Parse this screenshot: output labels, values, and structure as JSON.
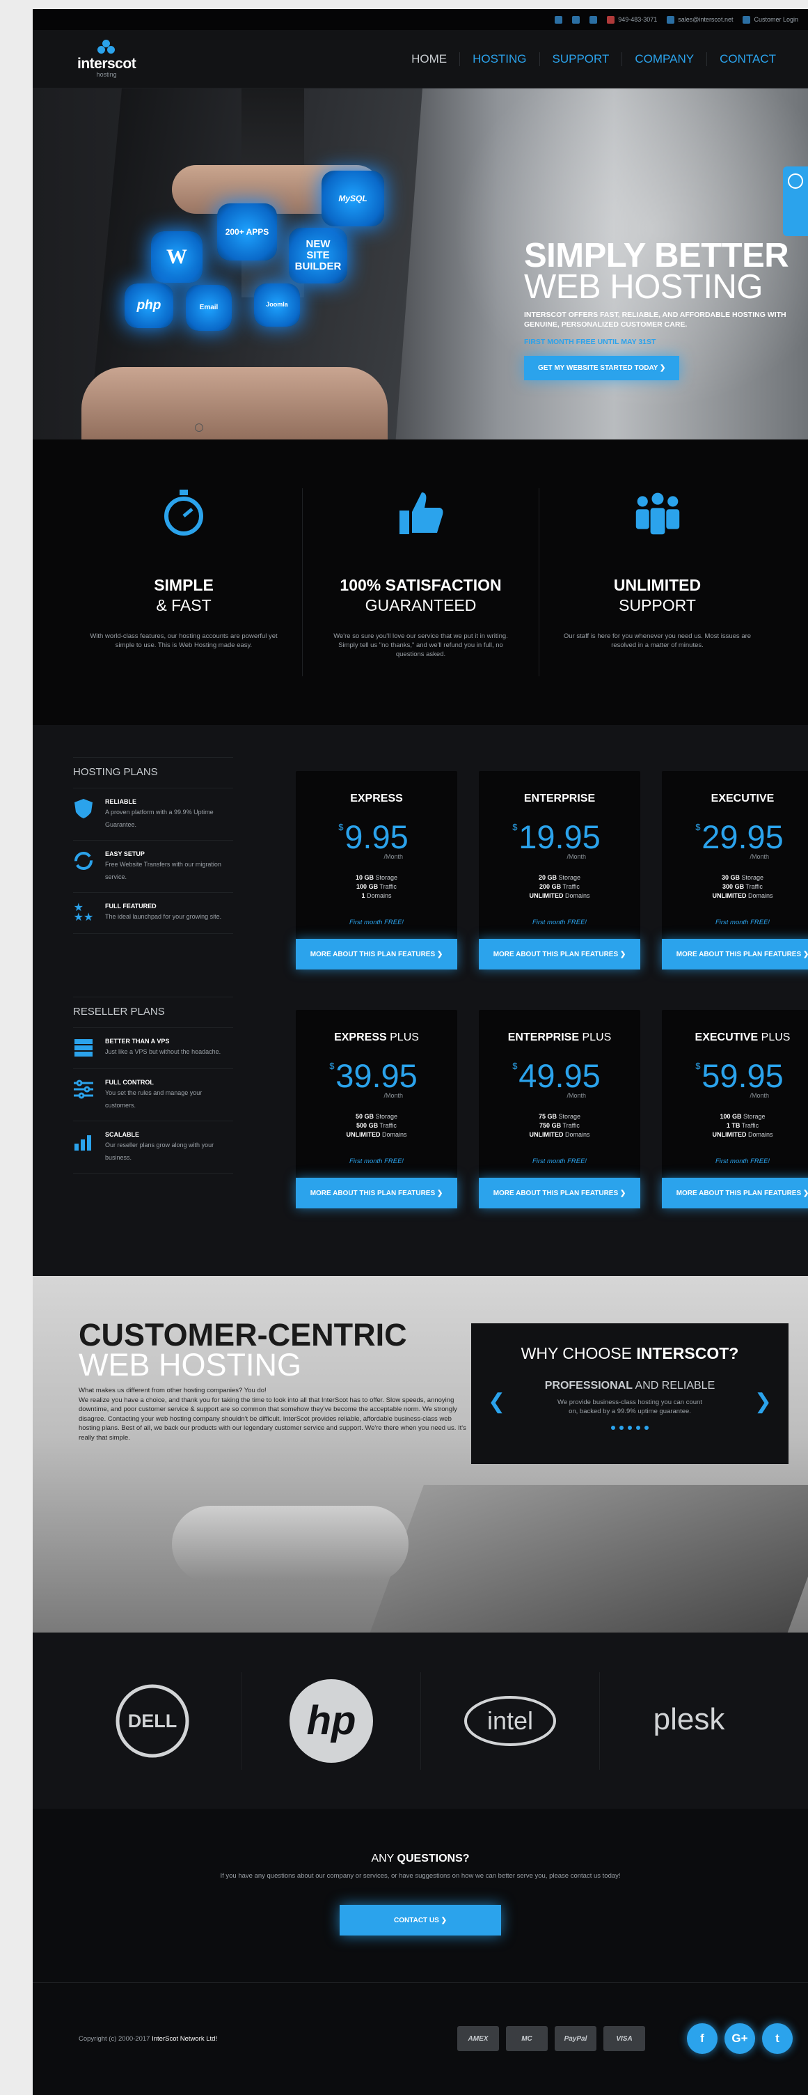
{
  "util": {
    "phone": "949-483-3071",
    "email": "sales@interscot.net",
    "login": "Customer Login",
    "flag": "US"
  },
  "header": {
    "logo_name": "interscot",
    "logo_sub": "hosting",
    "nav": [
      "HOME",
      "HOSTING",
      "SUPPORT",
      "COMPANY",
      "CONTACT"
    ]
  },
  "hero": {
    "gears": [
      "WordPress",
      "php",
      "200+ APPS",
      "Email",
      "NEW SITE BUILDER",
      "MySQL",
      "Joomla"
    ],
    "title_bold": "SIMPLY BETTER",
    "title_light": "WEB HOSTING",
    "text": "INTERSCOT OFFERS FAST, RELIABLE, AND AFFORDABLE HOSTING WITH GENUINE, PERSONALIZED CUSTOMER CARE.",
    "promo": "FIRST MONTH FREE UNTIL MAY 31ST",
    "cta": "GET MY WEBSITE STARTED TODAY ❯"
  },
  "features": [
    {
      "icon": "stopwatch-icon",
      "title": "SIMPLE",
      "sub": "& FAST",
      "text": "With world-class features, our hosting accounts are powerful yet simple to use. This is Web Hosting made easy."
    },
    {
      "icon": "thumbs-up-icon",
      "title": "100% SATISFACTION",
      "sub": "GUARANTEED",
      "text": "We're so sure you'll love our service that we put it in writing. Simply tell us \"no thanks,\" and we'll refund you in full, no questions asked."
    },
    {
      "icon": "team-icon",
      "title": "UNLIMITED",
      "sub": "SUPPORT",
      "text": "Our staff is here for you whenever you need us. Most issues are resolved in a matter of minutes."
    }
  ],
  "plans": {
    "hosting_title": "HOSTING PLANS",
    "hosting_perks": [
      {
        "icon": "shield-icon",
        "title": "RELIABLE",
        "text": "A proven platform with a 99.9% Uptime Guarantee."
      },
      {
        "icon": "sync-icon",
        "title": "EASY SETUP",
        "text": "Free Website Transfers with our migration service."
      },
      {
        "icon": "stars-icon",
        "title": "FULL FEATURED",
        "text": "The ideal launchpad for your growing site."
      }
    ],
    "reseller_title": "RESELLER PLANS",
    "reseller_perks": [
      {
        "icon": "server-icon",
        "title": "BETTER THAN A VPS",
        "text": "Just like a VPS but without the headache."
      },
      {
        "icon": "sliders-icon",
        "title": "FULL CONTROL",
        "text": "You set the rules and manage your customers."
      },
      {
        "icon": "growth-chart-icon",
        "title": "SCALABLE",
        "text": "Our reseller plans grow along with your business."
      }
    ],
    "cards": [
      {
        "name": "EXPRESS",
        "suffix": "",
        "price": "9.95",
        "storage": "10 GB",
        "traffic": "100 GB",
        "domains": "1"
      },
      {
        "name": "ENTERPRISE",
        "suffix": "",
        "price": "19.95",
        "storage": "20 GB",
        "traffic": "200 GB",
        "domains": "UNLIMITED"
      },
      {
        "name": "EXECUTIVE",
        "suffix": "",
        "price": "29.95",
        "storage": "30 GB",
        "traffic": "300 GB",
        "domains": "UNLIMITED"
      },
      {
        "name": "EXPRESS",
        "suffix": " PLUS",
        "price": "39.95",
        "storage": "50 GB",
        "traffic": "500 GB",
        "domains": "UNLIMITED"
      },
      {
        "name": "ENTERPRISE",
        "suffix": " PLUS",
        "price": "49.95",
        "storage": "75 GB",
        "traffic": "750 GB",
        "domains": "UNLIMITED"
      },
      {
        "name": "EXECUTIVE",
        "suffix": " PLUS",
        "price": "59.95",
        "storage": "100 GB",
        "traffic": "1 TB",
        "domains": "UNLIMITED"
      }
    ],
    "currency": "$",
    "per": "/Month",
    "storage_label": "Storage",
    "traffic_label": "Traffic",
    "domains_label": "Domains",
    "first_month": "First month FREE!",
    "more": "MORE ABOUT THIS PLAN FEATURES ❯"
  },
  "customer": {
    "title_bold": "CUSTOMER-CENTRIC",
    "title_light": "WEB HOSTING",
    "lead": "What makes us different from other hosting companies? You do!",
    "text": "We realize you have a choice, and thank you for taking the time to look into all that InterScot has to offer. Slow speeds, annoying downtime, and poor customer service & support are so common that somehow they've become the acceptable norm. We strongly disagree. Contacting your web hosting company shouldn't be difficult. InterScot provides reliable, affordable business-class web hosting plans. Best of all, we back our products with our legendary customer service and support. We're there when you need us. It's really that simple.",
    "why_pre": "WHY CHOOSE",
    "why_bold": "INTERSCOT?",
    "why_sub_bold": "PROFESSIONAL",
    "why_sub_light": " AND RELIABLE",
    "why_text": "We provide business-class hosting you can count on, backed by a 99.9% uptime guarantee."
  },
  "partners": [
    "DELL",
    "hp",
    "intel",
    "plesk"
  ],
  "questions": {
    "pre": "ANY ",
    "bold": "QUESTIONS?",
    "text": "If you have any questions about our company or services, or have suggestions on how we can better serve you, please contact us today!",
    "cta": "CONTACT US ❯"
  },
  "footer": {
    "copy": "Copyright (c) 2000-2017 ",
    "copy_bold": "InterScot Network Ltd!",
    "payments": [
      "AMEX",
      "MC",
      "PayPal",
      "VISA"
    ],
    "social": [
      "f",
      "G+",
      "t"
    ]
  },
  "colors": {
    "accent": "#2ba3ec",
    "bg": "#0b0c0e"
  }
}
